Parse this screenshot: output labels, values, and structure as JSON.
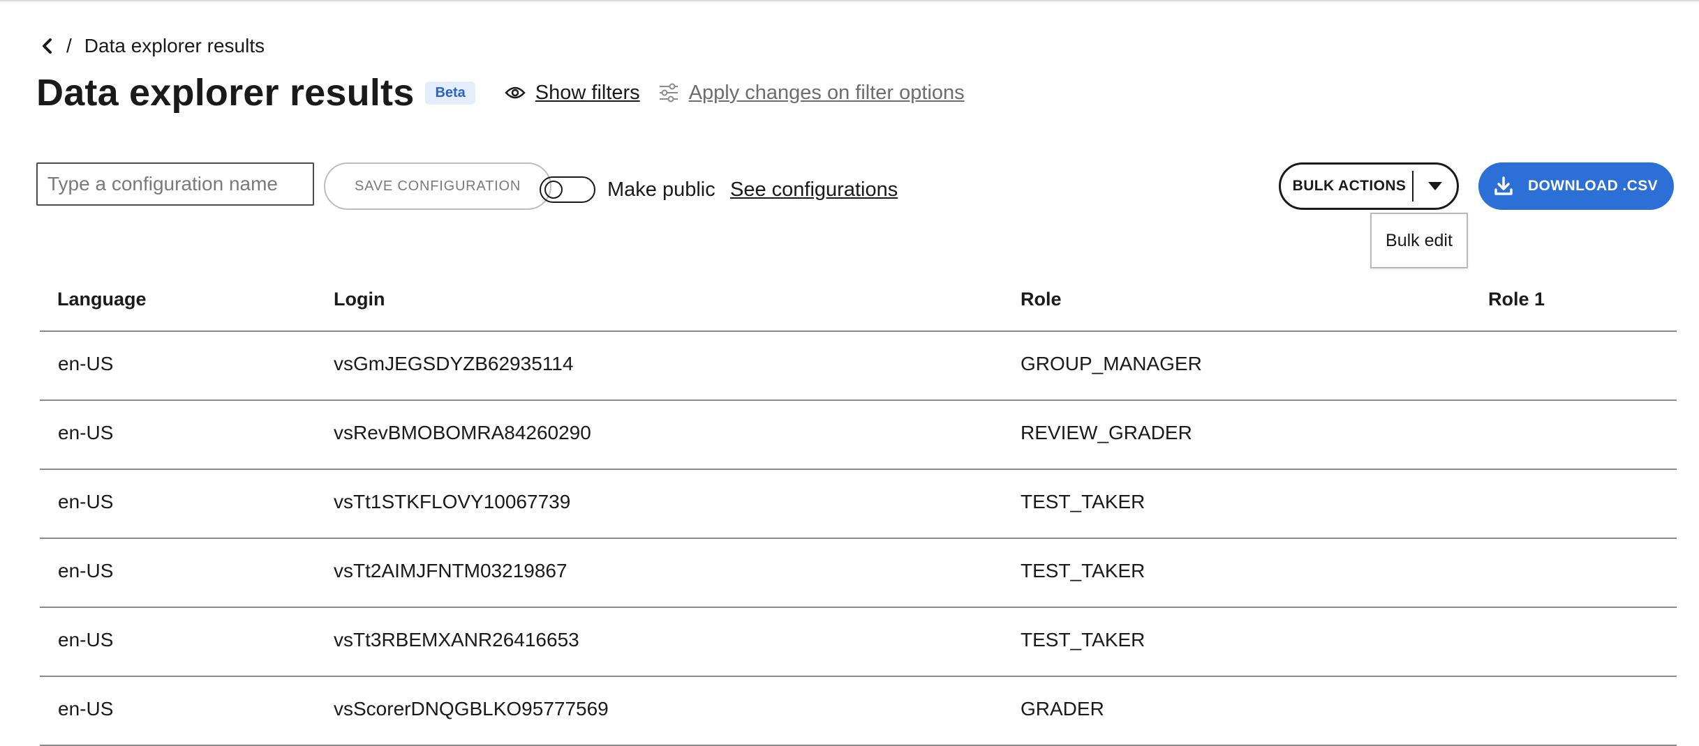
{
  "breadcrumb": {
    "current": "Data explorer results",
    "separator": "/"
  },
  "header": {
    "title": "Data explorer results",
    "badge": "Beta",
    "show_filters": "Show filters",
    "apply_changes": "Apply changes on filter options"
  },
  "config": {
    "input_value": "",
    "input_placeholder": "Type a configuration name",
    "save_label": "SAVE CONFIGURATION",
    "make_public_label": "Make public",
    "make_public_on": false,
    "see_configurations": "See configurations"
  },
  "bulk_actions": {
    "label": "BULK ACTIONS",
    "menu_items": [
      "Bulk edit"
    ]
  },
  "download": {
    "label": "DOWNLOAD .CSV"
  },
  "colors": {
    "accent": "#2c6fd6",
    "badge_bg": "#e3edfb",
    "badge_text": "#2c63c4"
  },
  "table": {
    "columns": [
      "Language",
      "Login",
      "Role",
      "Role 1"
    ],
    "rows": [
      [
        "en-US",
        "vsGmJEGSDYZB62935114",
        "GROUP_MANAGER",
        ""
      ],
      [
        "en-US",
        "vsRevBMOBOMRA84260290",
        "REVIEW_GRADER",
        ""
      ],
      [
        "en-US",
        "vsTt1STKFLOVY10067739",
        "TEST_TAKER",
        ""
      ],
      [
        "en-US",
        "vsTt2AIMJFNTM03219867",
        "TEST_TAKER",
        ""
      ],
      [
        "en-US",
        "vsTt3RBEMXANR26416653",
        "TEST_TAKER",
        ""
      ],
      [
        "en-US",
        "vsScorerDNQGBLKO95777569",
        "GRADER",
        ""
      ]
    ]
  }
}
